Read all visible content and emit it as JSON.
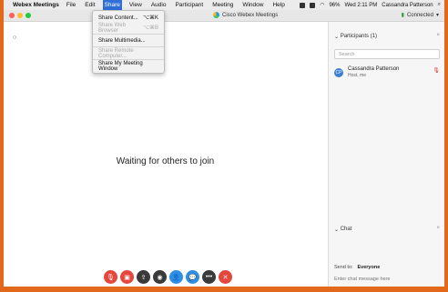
{
  "menubar": {
    "app_name": "Webex Meetings",
    "items": [
      "File",
      "Edit",
      "Share",
      "View",
      "Audio",
      "Participant",
      "Meeting",
      "Window",
      "Help"
    ],
    "active_index": 2,
    "tray": {
      "battery": "96%",
      "clock": "Wed 2:11 PM",
      "user": "Cassandra Patterson"
    }
  },
  "window": {
    "title": "Cisco Webex Meetings",
    "status": "Connected"
  },
  "share_menu": {
    "items": [
      {
        "label": "Share Content...",
        "shortcut": "⌥⌘K",
        "enabled": true
      },
      {
        "label": "Share Web Browser",
        "shortcut": "⌥⌘B",
        "enabled": false
      },
      {
        "label": "Share Multimedia...",
        "shortcut": "",
        "enabled": true
      },
      {
        "label": "Share Remote Computer...",
        "shortcut": "",
        "enabled": false
      },
      {
        "label": "Share My Meeting Window",
        "shortcut": "",
        "enabled": true
      }
    ]
  },
  "stage": {
    "message": "Waiting for others to join"
  },
  "controls": [
    {
      "name": "mute-button",
      "icon": "microphone-icon",
      "glyph": "🎙",
      "color": "#e5473c"
    },
    {
      "name": "video-button",
      "icon": "video-icon",
      "glyph": "▣",
      "color": "#e5473c"
    },
    {
      "name": "share-button",
      "icon": "share-icon",
      "glyph": "⇪",
      "color": "#3a3a3a"
    },
    {
      "name": "record-button",
      "icon": "record-icon",
      "glyph": "◉",
      "color": "#3a3a3a"
    },
    {
      "name": "participants-button",
      "icon": "person-icon",
      "glyph": "👤",
      "color": "#2d8ee4"
    },
    {
      "name": "chat-button",
      "icon": "chat-icon",
      "glyph": "💬",
      "color": "#2d8ee4"
    },
    {
      "name": "more-button",
      "icon": "more-icon",
      "glyph": "•••",
      "color": "#3a3a3a"
    },
    {
      "name": "leave-button",
      "icon": "close-icon",
      "glyph": "✕",
      "color": "#e5473c"
    }
  ],
  "participants": {
    "header": "Participants (1)",
    "search_placeholder": "Search",
    "list": [
      {
        "name": "Cassandra Patterson",
        "role": "Host, me",
        "initials": "CP"
      }
    ]
  },
  "chat": {
    "header": "Chat",
    "send_to_label": "Send to:",
    "send_to_value": "Everyone",
    "input_placeholder": "Enter chat message here"
  }
}
